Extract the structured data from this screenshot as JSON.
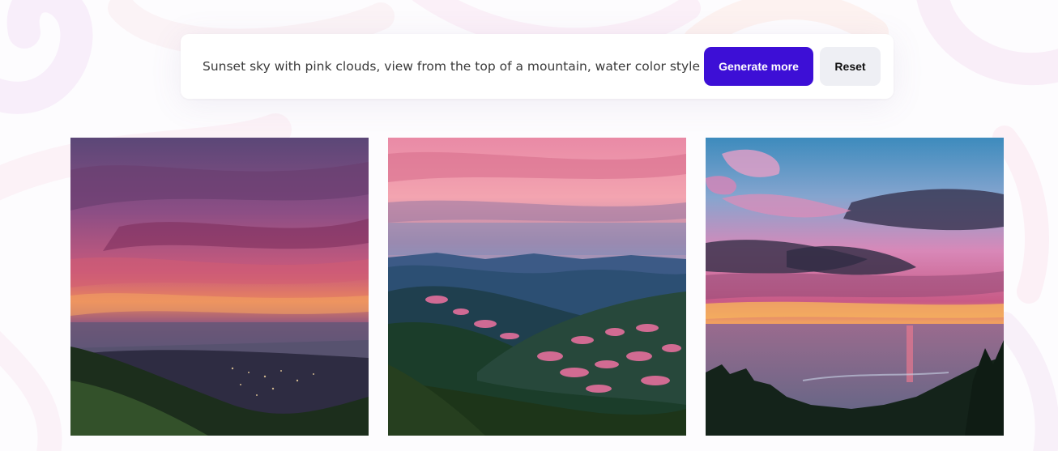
{
  "prompt": {
    "value": "Sunset sky with pink clouds, view from the top of a mountain, water color style"
  },
  "actions": {
    "generate_label": "Generate more",
    "reset_label": "Reset"
  },
  "colors": {
    "primary": "#3d0fd6",
    "secondary_button": "#eeeff4",
    "card": "#ffffff",
    "page_background": "#fdfcfe"
  },
  "results": {
    "images": [
      {
        "subject": "purple and pink sunset sky over a misty valley with city lights, mountain slope in foreground"
      },
      {
        "subject": "pink sunset clouds over layered blue mountains covered in pink blossoming trees"
      },
      {
        "subject": "dramatic pink and purple clouds with orange sunset reflecting on the sea, tree silhouettes"
      }
    ]
  }
}
